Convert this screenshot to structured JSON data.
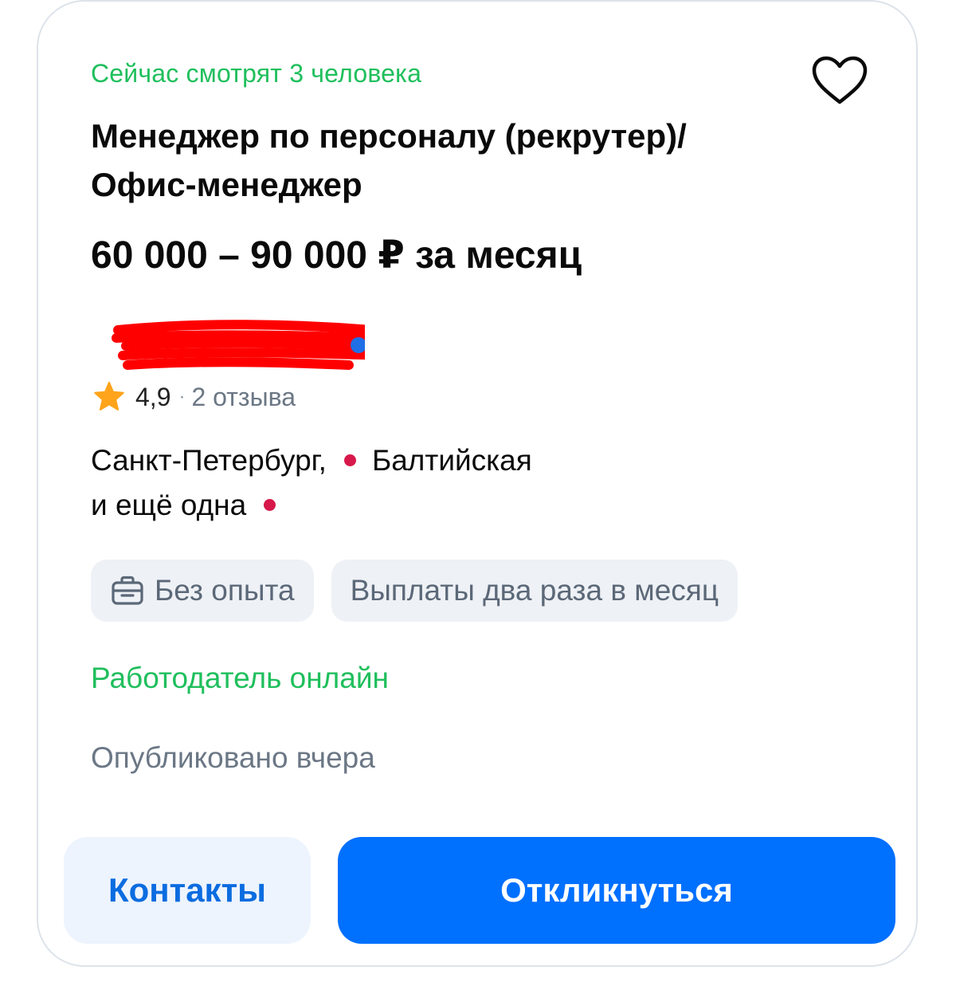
{
  "card": {
    "viewers_text": "Сейчас смотрят 3 человека",
    "favorite_icon": "heart-outline-icon",
    "title": "Менеджер по персоналу (рекрутер)/Офис-менеджер",
    "salary": "60 000 – 90 000 ₽ за месяц",
    "company": {
      "redacted": true,
      "redaction_color": "#ff0000"
    },
    "rating": {
      "score": "4,9",
      "separator": "·",
      "reviews": "2 отзыва",
      "star_color": "#ffa41b"
    },
    "location": {
      "city": "Санкт-Петербург,",
      "metro": "Балтийская",
      "more": "и ещё одна",
      "metro_color": "#d6184a"
    },
    "tags": [
      {
        "label": "Без опыта",
        "icon": "briefcase-icon"
      },
      {
        "label": "Выплаты два раза в месяц"
      }
    ],
    "employer_status": "Работодатель онлайн",
    "published": "Опубликовано вчера",
    "buttons": {
      "contacts": "Контакты",
      "apply": "Откликнуться"
    }
  },
  "colors": {
    "accent_green": "#1fbf5c",
    "primary_blue": "#0070ff",
    "secondary_button_bg": "#edf4fe",
    "muted_text": "#6b7785"
  }
}
